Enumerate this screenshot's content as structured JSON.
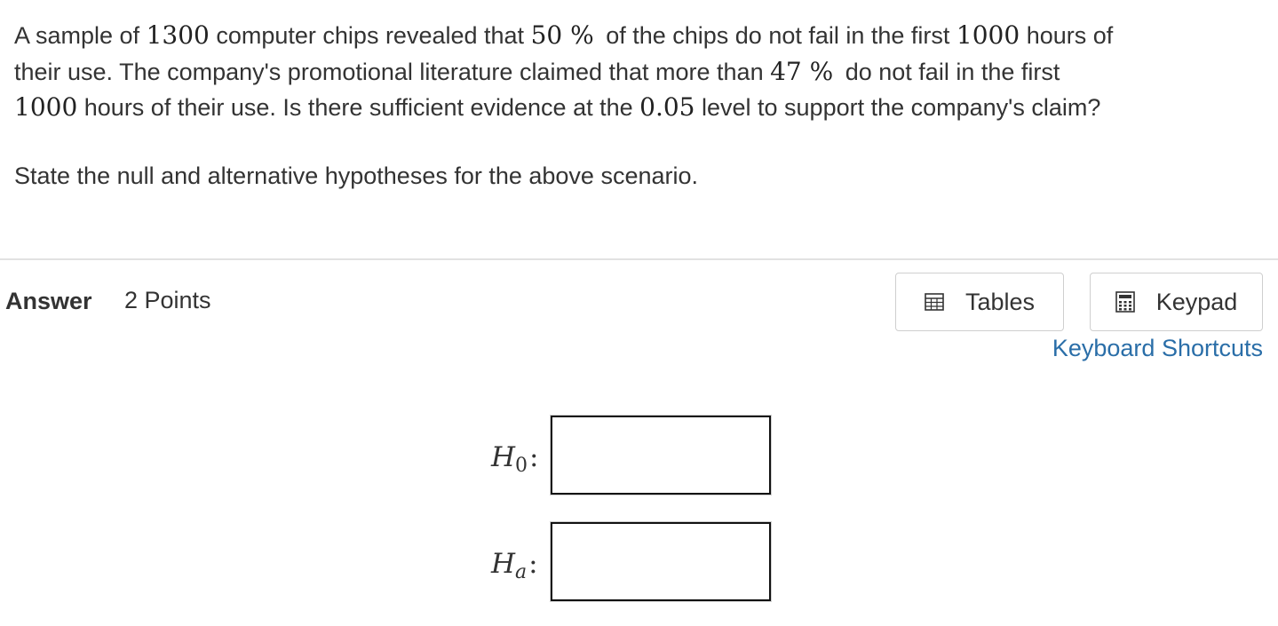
{
  "question": {
    "line1_a": "A sample of ",
    "n": "1300",
    "line1_b": " computer chips revealed that ",
    "p_hat": "50 %",
    "line1_c": " of the chips do not fail in the first ",
    "hours1": "1000",
    "line1_d": " hours of",
    "line2_a": "their use. The company's promotional literature claimed that more than ",
    "p0": "47 %",
    "line2_b": " do not fail in the first",
    "hours2": "1000",
    "line3_a": " hours of their use. Is there sufficient evidence at the ",
    "alpha": "0.05",
    "line3_b": " level to support the company's claim?"
  },
  "prompt": "State the null and alternative hypotheses for the above scenario.",
  "answer": {
    "label": "Answer",
    "points": "2 Points"
  },
  "toolbar": {
    "tables_label": "Tables",
    "tables_icon": "table-grid-icon",
    "keypad_label": "Keypad",
    "keypad_icon": "calculator-icon",
    "shortcuts_label": "Keyboard Shortcuts"
  },
  "hypotheses": {
    "null_symbol": "H",
    "null_sub": "0",
    "alt_symbol": "H",
    "alt_sub": "a",
    "colon": ":",
    "null_value": "",
    "alt_value": ""
  },
  "colors": {
    "text": "#333333",
    "link": "#2a6ea8",
    "divider": "#e2e2e2",
    "button_border": "#cfcfcf",
    "input_border": "#111111"
  }
}
